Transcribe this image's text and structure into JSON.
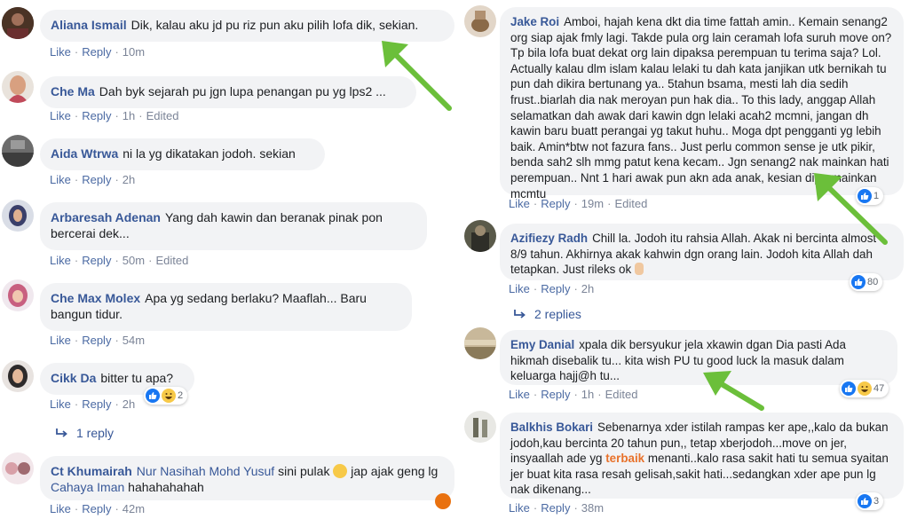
{
  "actions": {
    "like": "Like",
    "reply": "Reply",
    "edited": "Edited"
  },
  "left": [
    {
      "author": "Aliana Ismail",
      "text": "Dik, kalau aku jd pu riz pun aku pilih lofa dik, sekian.",
      "time": "10m",
      "edited": false
    },
    {
      "author": "Che Ma",
      "text": "Dah byk sejarah pu jgn lupa penangan pu yg lps2 ...",
      "time": "1h",
      "edited": true
    },
    {
      "author": "Aida Wtrwa",
      "text": "ni la yg dikatakan jodoh. sekian",
      "time": "2h",
      "edited": false
    },
    {
      "author": "Arbaresah Adenan",
      "text": "Yang dah kawin dan beranak pinak pon bercerai dek...",
      "time": "50m",
      "edited": true
    },
    {
      "author": "Che Max Molex",
      "text": "Apa yg sedang berlaku? Maaflah... Baru bangun tidur.",
      "time": "54m",
      "edited": false
    },
    {
      "author": "Cikk Da",
      "text": "bitter tu apa?",
      "time": "2h",
      "edited": false,
      "reactions": "2"
    },
    {
      "replies": "1 reply"
    },
    {
      "author": "Ct Khumairah",
      "mention": "Nur Nasihah Mohd Yusuf",
      "text": "sini pulak",
      "text2": "jap ajak geng lg",
      "mention2": "Cahaya Iman",
      "text3": "hahahahahah",
      "time": "42m",
      "edited": false
    }
  ],
  "right": [
    {
      "author": "Jake Roi",
      "text": "Amboi, hajah kena dkt dia time fattah amin.. Kemain senang2 org siap ajak fmly lagi. Takde pula org lain ceramah lofa suruh move on? Tp bila lofa buat dekat org lain dipaksa perempuan tu terima saja? Lol. Actually kalau dlm islam kalau lelaki tu dah kata janjikan utk bernikah tu pun dah dikira bertunang ya.. 5tahun bsama, mesti lah dia sedih frust..biarlah dia nak meroyan pun hak dia.. To this lady, anggap Allah selamatkan dah awak dari kawin dgn lelaki acah2 mcmni, jangan dh kawin baru buatt perangai yg takut huhu.. Moga dpt pengganti yg lebih baik. Amin*btw not fazura fans.. Just perlu common sense je utk pikir, benda sah2 slh mmg patut kena kecam.. Jgn senang2 nak mainkan hati perempuan.. Nnt 1 hari awak pun akn ada anak, kesian dipermainkan mcmtu",
      "time": "19m",
      "edited": true,
      "reactions": "1"
    },
    {
      "author": "Azifiezy Radh",
      "text": "Chill la. Jodoh itu rahsia Allah. Akak ni bercinta almost 8/9 tahun. Akhirnya akak kahwin dgn orang lain. Jodoh kita Allah dah tetapkan. Just rileks ok",
      "time": "2h",
      "edited": false,
      "reactions": "80"
    },
    {
      "replies": "2 replies"
    },
    {
      "author": "Emy Danial",
      "text": "xpala dik bersyukur jela xkawin dgan Dia pasti Ada hikmah disebalik tu... kita wish PU tu good luck la masuk dalam keluarga hajj@h tu...",
      "time": "1h",
      "edited": true,
      "reactions": "47"
    },
    {
      "author": "Balkhis Bokari",
      "text": "Sebenarnya xder istilah rampas ker ape,,kalo da bukan jodoh,kau bercinta 20 tahun pun,, tetap xberjodoh...move on jer, insyaallah ade yg",
      "highlight": "terbaik",
      "text2": "menanti..kalo rasa sakit hati tu semua syaitan jer buat kita rasa resah gelisah,sakit hati...sedangkan xder ape pun lg nak dikenang...",
      "time": "38m",
      "edited": false,
      "reactions": "3"
    }
  ],
  "colors": {
    "arrow": "#6bbf3a",
    "link": "#385898",
    "bubble": "#f2f3f5",
    "like": "#1877f2"
  }
}
